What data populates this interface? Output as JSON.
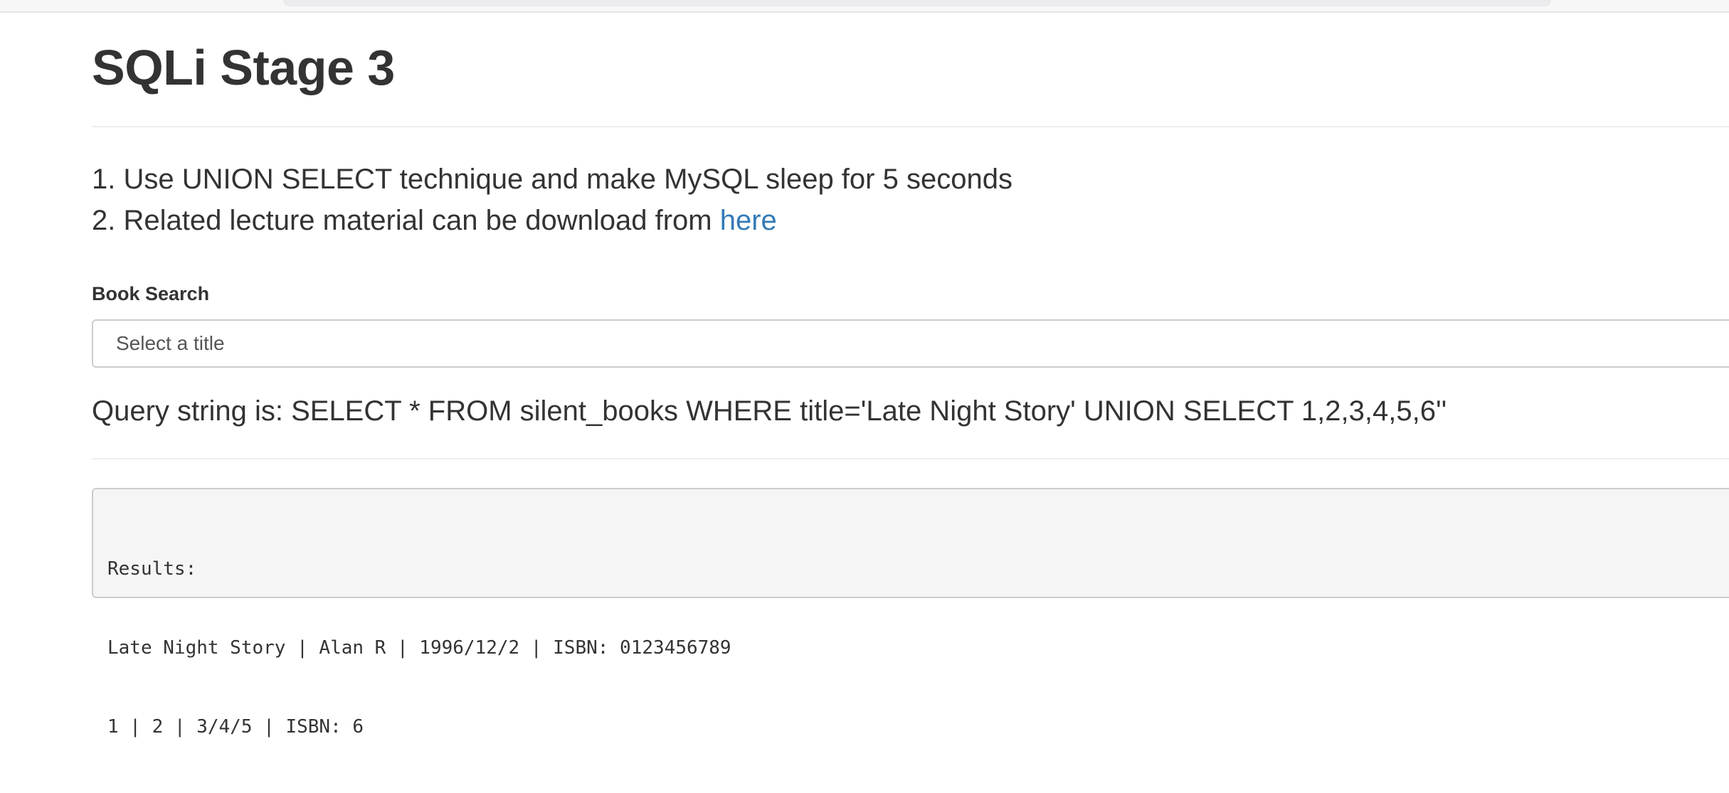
{
  "page": {
    "title": "SQLi Stage 3"
  },
  "instructions": {
    "item1": "1. Use UNION SELECT technique and make MySQL sleep for 5 seconds",
    "item2_prefix": "2. Related lecture material can be download from ",
    "item2_link": "here"
  },
  "search": {
    "label": "Book Search",
    "select_value": "Select a title"
  },
  "query": {
    "text": "Query string is: SELECT * FROM silent_books WHERE title='Late Night Story' UNION SELECT 1,2,3,4,5,6''"
  },
  "results": {
    "header": "Results:",
    "rows": [
      "Late Night Story | Alan R | 1996/12/2 | ISBN: 0123456789",
      "1 | 2 | 3/4/5 | ISBN: 6"
    ]
  },
  "colors": {
    "link": "#337ab7",
    "text": "#333333",
    "results_bg": "#f5f5f5"
  }
}
